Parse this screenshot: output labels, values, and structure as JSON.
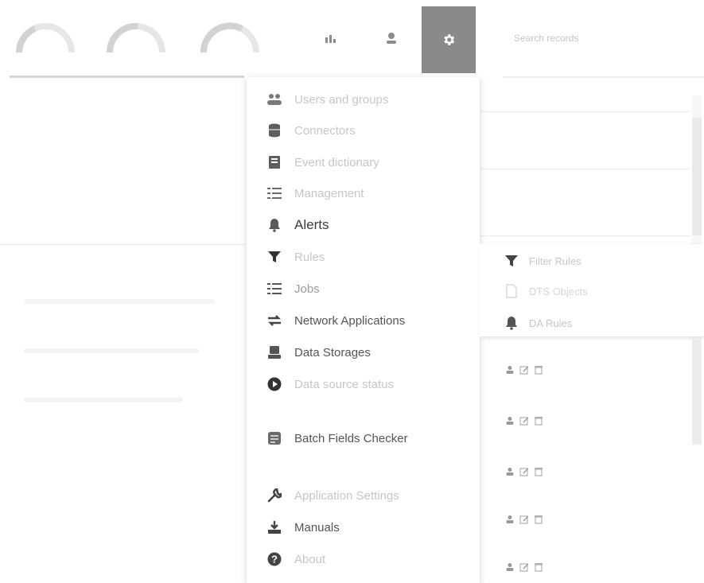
{
  "header": {
    "search_placeholder": "Search records",
    "icons": [
      "gauge-icon",
      "gauge-icon",
      "gauge-icon",
      "chart-icon",
      "user-icon",
      "gear-icon"
    ],
    "active_button_color": "#8a8a8a"
  },
  "menu": {
    "items": [
      {
        "label": "Users and groups",
        "icon": "users-icon"
      },
      {
        "label": "Connectors",
        "icon": "database-icon"
      },
      {
        "label": "Event dictionary",
        "icon": "book-icon"
      },
      {
        "label": "Management",
        "icon": "list-icon"
      },
      {
        "label": "Alerts",
        "icon": "bell-icon"
      },
      {
        "label": "Rules",
        "icon": "filter-icon"
      },
      {
        "label": "Jobs",
        "icon": "list-icon"
      },
      {
        "label": "Network Applications",
        "icon": "swap-icon"
      },
      {
        "label": "Data Storages",
        "icon": "storage-icon"
      },
      {
        "label": "Data source status",
        "icon": "play-circle-icon"
      },
      {
        "label": "Batch Fields Checker",
        "icon": "checker-icon"
      },
      {
        "label": "Application Settings",
        "icon": "wrench-icon"
      },
      {
        "label": "Manuals",
        "icon": "download-icon"
      },
      {
        "label": "About",
        "icon": "question-icon"
      }
    ]
  },
  "submenu": {
    "items": [
      {
        "label": "Filter Rules",
        "icon": "filter-icon"
      },
      {
        "label": "DTS Objects",
        "icon": "file-icon"
      },
      {
        "label": "DA Rules",
        "icon": "bell-icon"
      }
    ]
  },
  "table": {
    "row_actions": [
      "user-icon",
      "edit-icon",
      "trash-icon"
    ]
  }
}
